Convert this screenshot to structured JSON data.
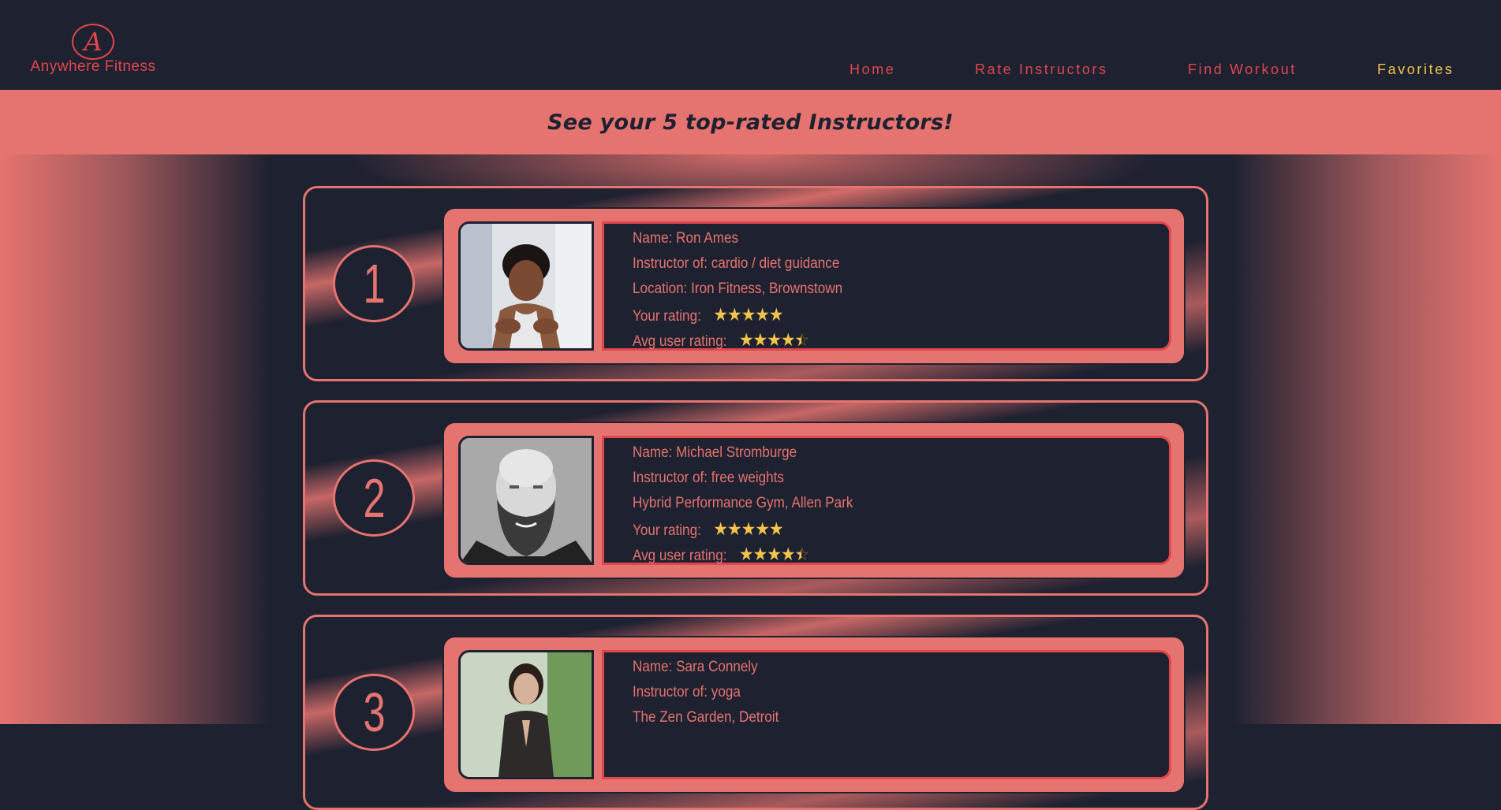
{
  "brand": {
    "logo_letter": "A",
    "name": "Anywhere Fitness"
  },
  "nav": [
    {
      "label": "Home",
      "active": false
    },
    {
      "label": "Rate Instructors",
      "active": false
    },
    {
      "label": "Find Workout",
      "active": false
    },
    {
      "label": "Favorites",
      "active": true
    }
  ],
  "banner": {
    "title": "See your 5 top-rated Instructors!"
  },
  "rating_labels": {
    "yours": "Your rating:",
    "avg": "Avg user rating:"
  },
  "cards": [
    {
      "rank": "1",
      "name_line": "Name: Ron Ames",
      "instructor_line": "Instructor of: cardio / diet guidance",
      "location_line": "Location: Iron Fitness, Brownstown",
      "your_rating": 5,
      "avg_rating": 4.5
    },
    {
      "rank": "2",
      "name_line": "Name: Michael Stromburge",
      "instructor_line": "Instructor of: free weights",
      "location_line": "Hybrid Performance Gym, Allen Park",
      "your_rating": 5,
      "avg_rating": 4.5
    },
    {
      "rank": "3",
      "name_line": "Name: Sara Connely",
      "instructor_line": "Instructor of: yoga",
      "location_line": "The Zen Garden, Detroit"
    }
  ],
  "colors": {
    "dark": "#1e2130",
    "coral": "#e5736f",
    "red": "#e0474c",
    "gold": "#f3c44b"
  },
  "icons": {
    "star": "star-icon",
    "half_star": "half-star-icon"
  }
}
